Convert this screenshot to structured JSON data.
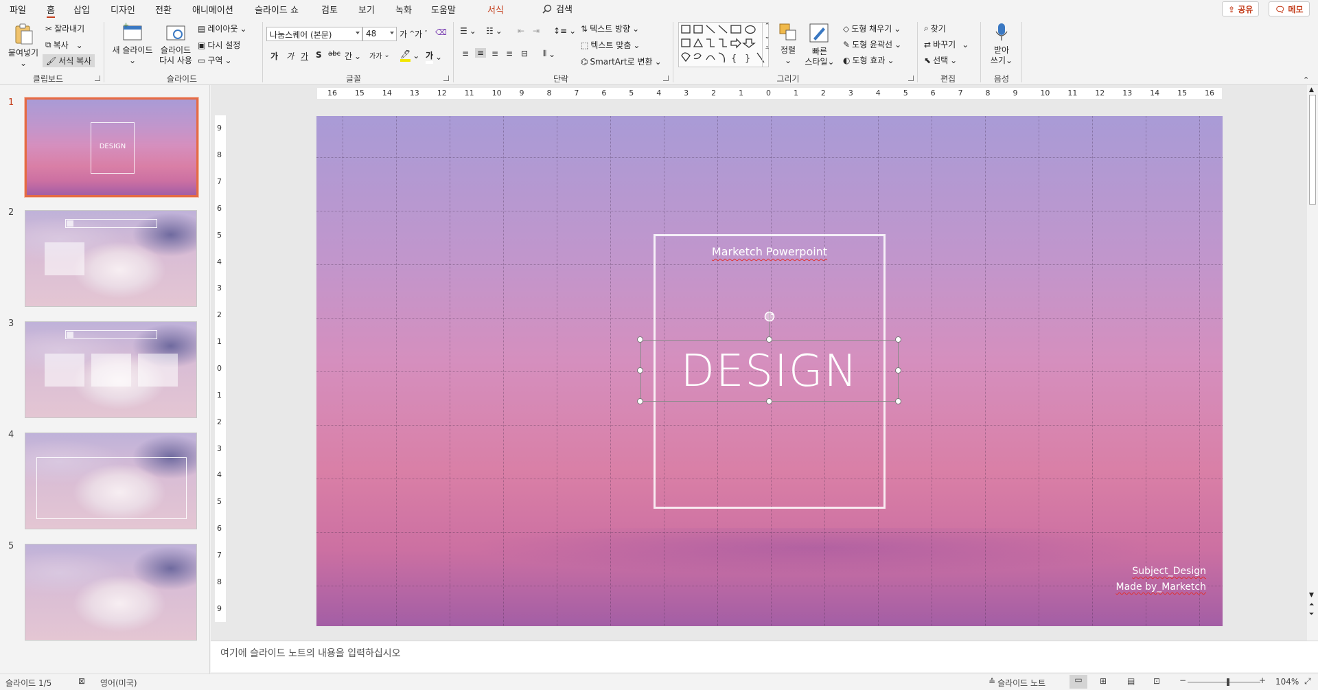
{
  "tabs": [
    "파일",
    "홈",
    "삽입",
    "디자인",
    "전환",
    "애니메이션",
    "슬라이드 쇼",
    "검토",
    "보기",
    "녹화",
    "도움말",
    "서식"
  ],
  "search": {
    "label": "검색"
  },
  "share": {
    "share_label": "공유",
    "memo_label": "메모"
  },
  "ribbon": {
    "clipboard": {
      "paste": "붙여넣기",
      "cut": "잘라내기",
      "copy": "복사",
      "format_painter": "서식 복사",
      "group": "클립보드"
    },
    "slides": {
      "new_slide": "새 슬라이드",
      "reuse_1": "슬라이드",
      "reuse_2": "다시 사용",
      "layout": "레이아웃",
      "reset": "다시 설정",
      "section": "구역",
      "group": "슬라이드"
    },
    "font": {
      "font_name": "나눔스퀘어 (본문)",
      "font_size": "48",
      "grow": "가",
      "shrink": "가",
      "bold": "가",
      "italic": "가",
      "underline": "가",
      "shadow": "S",
      "strike": "abc",
      "spacing": "간",
      "case": "가가",
      "group": "글꼴"
    },
    "paragraph": {
      "text_direction": "텍스트 방향",
      "align_text": "텍스트 맞춤",
      "smartart": "SmartArt로 변환",
      "group": "단락"
    },
    "drawing": {
      "arrange": "정렬",
      "quick_styles_1": "빠른",
      "quick_styles_2": "스타일",
      "shape_fill": "도형 채우기",
      "shape_outline": "도형 윤곽선",
      "shape_effects": "도형 효과",
      "group": "그리기"
    },
    "editing": {
      "find": "찾기",
      "replace": "바꾸기",
      "select": "선택",
      "group": "편집"
    },
    "voice": {
      "dictate_1": "받아",
      "dictate_2": "쓰기",
      "group": "음성"
    }
  },
  "thumbnails": [
    {
      "num": "1",
      "title": "DESIGN"
    },
    {
      "num": "2"
    },
    {
      "num": "3"
    },
    {
      "num": "4"
    },
    {
      "num": "5"
    }
  ],
  "ruler": {
    "h_ticks": [
      "16",
      "15",
      "14",
      "13",
      "12",
      "11",
      "10",
      "9",
      "8",
      "7",
      "6",
      "5",
      "4",
      "3",
      "2",
      "1",
      "0",
      "1",
      "2",
      "3",
      "4",
      "5",
      "6",
      "7",
      "8",
      "9",
      "10",
      "11",
      "12",
      "13",
      "14",
      "15",
      "16"
    ],
    "v_ticks": [
      "9",
      "8",
      "7",
      "6",
      "5",
      "4",
      "3",
      "2",
      "1",
      "0",
      "1",
      "2",
      "3",
      "4",
      "5",
      "6",
      "7",
      "8",
      "9"
    ]
  },
  "slide": {
    "subtitle": "Marketch Powerpoint",
    "title": "DESIGN",
    "footer_line1": "Subject_Design",
    "footer_line2": "Made by_Marketch"
  },
  "notes": {
    "placeholder": "여기에 슬라이드 노트의 내용을 입력하십시오"
  },
  "status": {
    "slide_count": "슬라이드 1/5",
    "language": "영어(미국)",
    "notes_button": "슬라이드 노트",
    "zoom": "104%",
    "zoom_level": 0.56
  },
  "colors": {
    "accent": "#c43e1c",
    "selected_thumb_border": "#e46b46"
  }
}
